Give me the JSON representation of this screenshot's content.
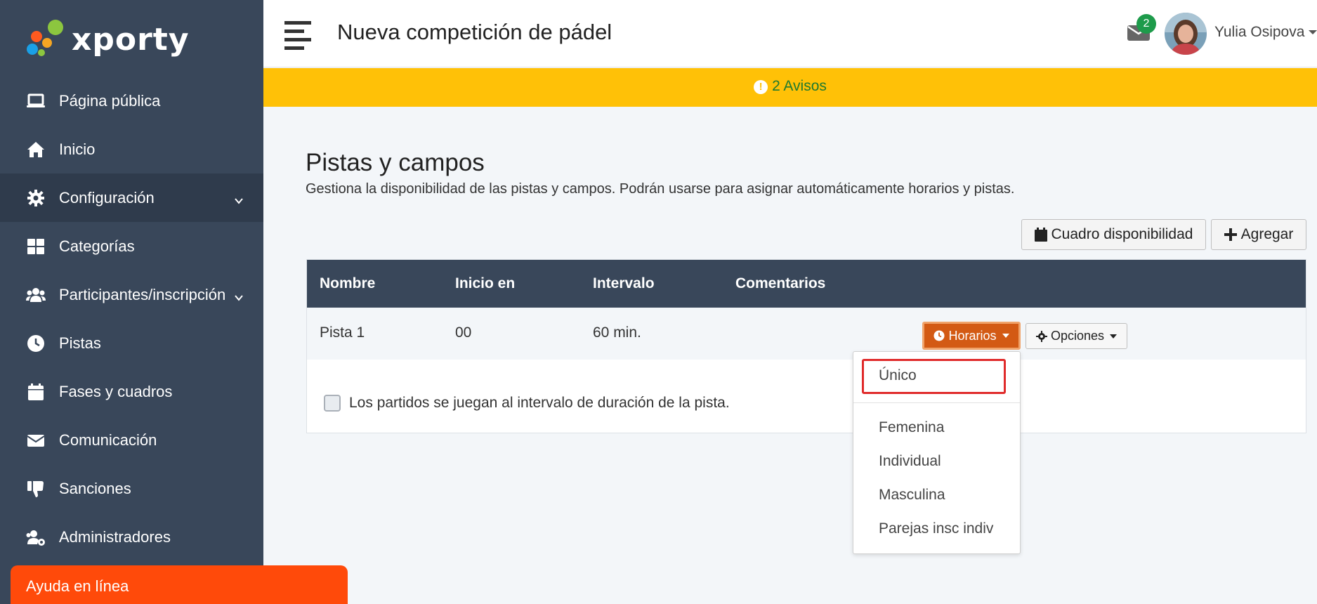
{
  "brand": {
    "name": "xporty"
  },
  "sidebar": {
    "items": [
      {
        "label": "Página pública",
        "icon": "laptop-icon"
      },
      {
        "label": "Inicio",
        "icon": "home-icon"
      },
      {
        "label": "Configuración",
        "icon": "gear-icon",
        "expandable": true,
        "active": true
      },
      {
        "label": "Categorías",
        "icon": "grid-icon"
      },
      {
        "label": "Participantes/inscripción",
        "icon": "users-icon",
        "expandable": true
      },
      {
        "label": "Pistas",
        "icon": "clock-icon"
      },
      {
        "label": "Fases y cuadros",
        "icon": "calendar-icon"
      },
      {
        "label": "Comunicación",
        "icon": "envelope-icon"
      },
      {
        "label": "Sanciones",
        "icon": "thumbs-down-icon"
      },
      {
        "label": "Administradores",
        "icon": "users-cog-icon"
      }
    ],
    "help_label": "Ayuda en línea"
  },
  "header": {
    "title": "Nueva competición de pádel",
    "mail_count": "2",
    "user_name": "Yulia Osipova"
  },
  "warning": {
    "text": "2 Avisos"
  },
  "main": {
    "title": "Pistas y campos",
    "description": "Gestiona la disponibilidad de las pistas y campos. Podrán usarse para asignar automáticamente horarios y pistas.",
    "availability_button": "Cuadro disponibilidad",
    "add_button": "Agregar",
    "table": {
      "columns": [
        "Nombre",
        "Inicio en",
        "Intervalo",
        "Comentarios"
      ],
      "rows": [
        {
          "nombre": "Pista 1",
          "inicio": "00",
          "intervalo": "60 min.",
          "comentarios": ""
        }
      ],
      "horarios_button": "Horarios",
      "opciones_button": "Opciones"
    },
    "checkbox_label": "Los partidos se juegan al intervalo de duración de la pista."
  },
  "dropdown": {
    "items": [
      "Único",
      "Femenina",
      "Individual",
      "Masculina",
      "Parejas insc indiv"
    ],
    "highlighted": "Único"
  },
  "colors": {
    "sidebar_bg": "#39475a",
    "warning_bg": "#ffc107",
    "help_button": "#ff4a0a",
    "horarios_button": "#d35a14",
    "badge": "#1e9b4b"
  }
}
